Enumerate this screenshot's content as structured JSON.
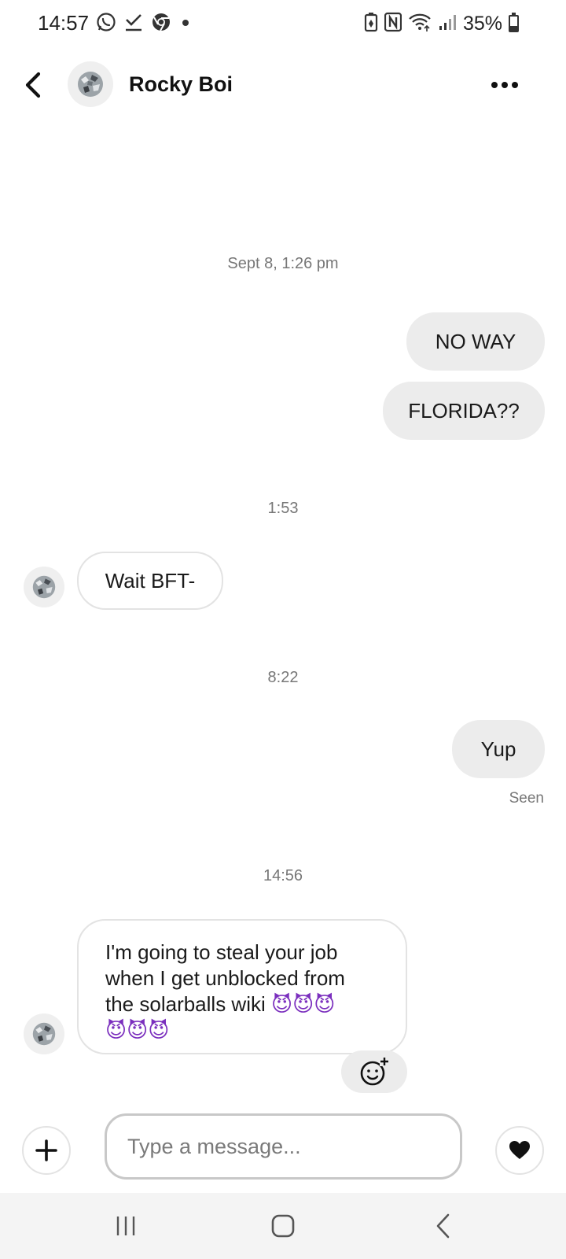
{
  "status_bar": {
    "time": "14:57",
    "battery_text": "35%",
    "battery_level": 0.35,
    "left_icons": [
      "whatsapp-icon",
      "download-done-icon",
      "chrome-icon",
      "notification-dot-icon"
    ],
    "right_icons": [
      "battery-saver-icon",
      "nfc-icon",
      "wifi-icon",
      "signal-icon"
    ]
  },
  "header": {
    "contact_name": "Rocky Boi",
    "back_icon": "back-arrow-icon",
    "more_icon": "more-options-icon"
  },
  "thread": {
    "groups": [
      {
        "timestamp": "Sept 8, 1:26 pm",
        "messages": [
          {
            "direction": "outgoing",
            "text": "NO WAY"
          },
          {
            "direction": "outgoing",
            "text": "FLORIDA??"
          }
        ]
      },
      {
        "timestamp": "1:53",
        "messages": [
          {
            "direction": "incoming",
            "text": "Wait BFT-"
          }
        ]
      },
      {
        "timestamp": "8:22",
        "messages": [
          {
            "direction": "outgoing",
            "text": "Yup",
            "status": "Seen"
          }
        ]
      },
      {
        "timestamp": "14:56",
        "messages": [
          {
            "direction": "incoming",
            "lines": [
              "I'm going to steal your job",
              "when I get unblocked from",
              "the solarballs wiki"
            ],
            "emoji_line1": "😈😈😈",
            "emoji_line2": "😈😈😈"
          }
        ]
      }
    ]
  },
  "composer": {
    "placeholder": "Type a message...",
    "value": "",
    "plus_icon": "plus-icon",
    "heart_icon": "heart-icon",
    "react_icon": "add-reaction-icon"
  },
  "nav_bar": {
    "icons": [
      "recent-apps-icon",
      "home-icon",
      "back-nav-icon"
    ]
  },
  "colors": {
    "outgoing_bubble": "#ececec",
    "incoming_bubble_border": "#e3e3e3",
    "timestamp_text": "#777777",
    "devil_emoji": "#7b2fbe"
  }
}
